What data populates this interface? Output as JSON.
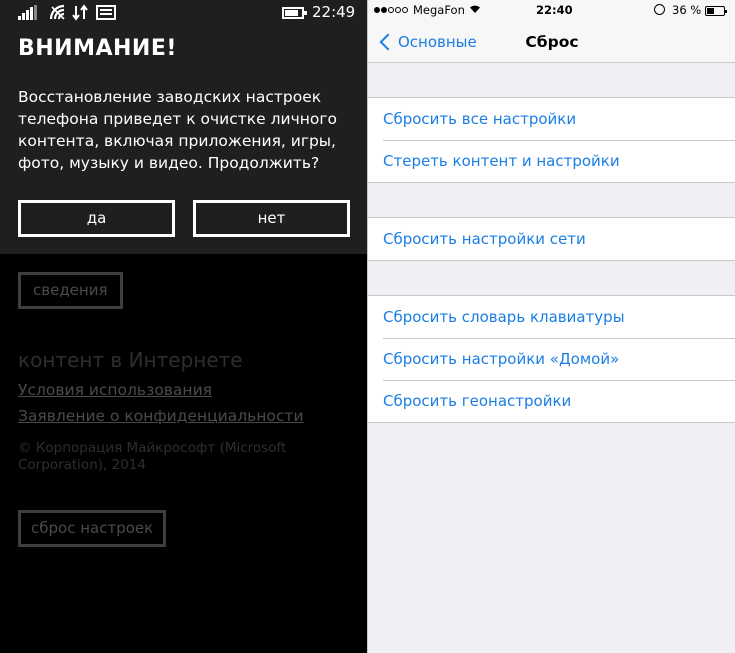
{
  "wp": {
    "status": {
      "time": "22:49"
    },
    "dialog": {
      "title": "ВНИМАНИЕ!",
      "message": "Восстановление заводских настроек телефона приведет к очистке личного контента, включая приложения, игры, фото, музыку и видео. Продолжить?",
      "yes_label": "да",
      "no_label": "нет"
    },
    "background": {
      "details_label": "сведения",
      "section_title": "контент в Интернете",
      "terms_link": "Условия использования",
      "privacy_link": "Заявление о конфиденциальности",
      "copyright": "© Корпорация Майкрософт (Microsoft Corporation), 2014",
      "reset_label": "сброс настроек"
    }
  },
  "ios": {
    "status": {
      "carrier": "MegaFon",
      "time": "22:40",
      "battery": "36 %"
    },
    "nav": {
      "back_label": "Основные",
      "title": "Сброс"
    },
    "groups": [
      {
        "items": [
          {
            "label": "Сбросить все настройки"
          },
          {
            "label": "Стереть контент и настройки"
          }
        ]
      },
      {
        "items": [
          {
            "label": "Сбросить настройки сети"
          }
        ]
      },
      {
        "items": [
          {
            "label": "Сбросить словарь клавиатуры"
          },
          {
            "label": "Сбросить настройки «Домой»"
          },
          {
            "label": "Сбросить геонастройки"
          }
        ]
      }
    ],
    "accent_color": "#1a7ee5"
  }
}
